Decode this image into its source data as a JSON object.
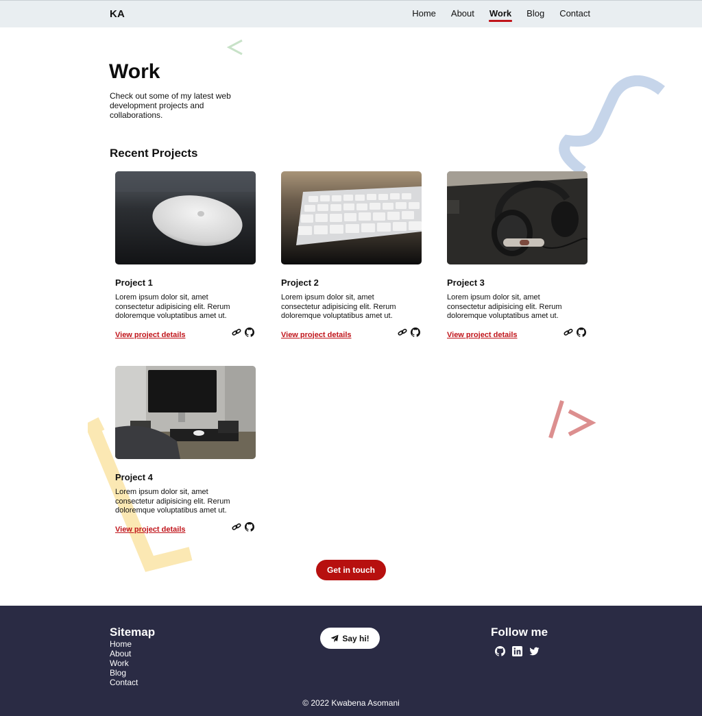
{
  "header": {
    "logo": "KA",
    "nav": [
      {
        "label": "Home",
        "active": false
      },
      {
        "label": "About",
        "active": false
      },
      {
        "label": "Work",
        "active": true
      },
      {
        "label": "Blog",
        "active": false
      },
      {
        "label": "Contact",
        "active": false
      }
    ]
  },
  "page": {
    "title": "Work",
    "intro": "Check out some of my latest web development projects and collaborations.",
    "section_title": "Recent Projects"
  },
  "projects": [
    {
      "title": "Project 1",
      "description": "Lorem ipsum dolor sit, amet consectetur adipisicing elit. Rerum doloremque voluptatibus amet ut.",
      "link": "View project details",
      "image": "magic-mouse-photo"
    },
    {
      "title": "Project 2",
      "description": "Lorem ipsum dolor sit, amet consectetur adipisicing elit. Rerum doloremque voluptatibus amet ut.",
      "link": "View project details",
      "image": "keyboard-photo"
    },
    {
      "title": "Project 3",
      "description": "Lorem ipsum dolor sit, amet consectetur adipisicing elit. Rerum doloremque voluptatibus amet ut.",
      "link": "View project details",
      "image": "headphones-photo"
    },
    {
      "title": "Project 4",
      "description": "Lorem ipsum dolor sit, amet consectetur adipisicing elit. Rerum doloremque voluptatibus amet ut.",
      "link": "View project details",
      "image": "desk-setup-photo"
    }
  ],
  "cta": {
    "label": "Get in touch"
  },
  "footer": {
    "sitemap_title": "Sitemap",
    "sitemap": [
      "Home",
      "About",
      "Work",
      "Blog",
      "Contact"
    ],
    "say_hi": "Say hi!",
    "follow_title": "Follow me",
    "social": [
      "github-icon",
      "linkedin-icon",
      "twitter-icon"
    ],
    "copyright": "© 2022 Kwabena Asomani"
  },
  "colors": {
    "accent": "#c0141a",
    "header_bg": "#e9eef1",
    "footer_bg": "#2a2b44"
  }
}
